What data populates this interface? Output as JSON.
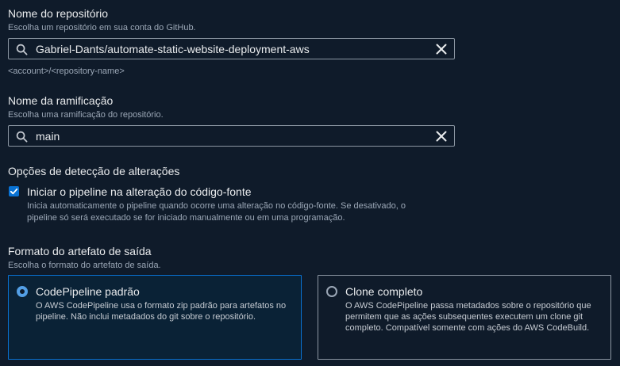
{
  "repository": {
    "label": "Nome do repositório",
    "description": "Escolha um repositório em sua conta do GitHub.",
    "value": "Gabriel-Dants/automate-static-website-deployment-aws",
    "hint": "<account>/<repository-name>"
  },
  "branch": {
    "label": "Nome da ramificação",
    "description": "Escolha uma ramificação do repositório.",
    "value": "main"
  },
  "change_detection": {
    "label": "Opções de detecção de alterações",
    "checkbox_label": "Iniciar o pipeline na alteração do código-fonte",
    "checkbox_checked": true,
    "checkbox_description_line1": "Inicia automaticamente o pipeline quando ocorre uma alteração no código-fonte. Se desativado, o",
    "checkbox_description_line2": "pipeline só será executado se for iniciado manualmente ou em uma programação."
  },
  "output_format": {
    "label": "Formato do artefato de saída",
    "description": "Escolha o formato do artefato de saída.",
    "options": [
      {
        "title": "CodePipeline padrão",
        "description": "O AWS CodePipeline usa o formato zip padrão para artefatos no pipeline. Não inclui metadados do git sobre o repositório.",
        "selected": true
      },
      {
        "title": "Clone completo",
        "description": "O AWS CodePipeline passa metadados sobre o repositório que permitem que as ações subsequentes executem um clone git completo. Compatível somente com ações do AWS CodeBuild.",
        "selected": false
      }
    ]
  },
  "colors": {
    "background": "#0f1b2a",
    "accent": "#0972d3",
    "radio_selected": "#539fe5",
    "border": "#8c97a3"
  },
  "icons": {
    "search": "search-icon",
    "clear": "close-icon",
    "check": "checkmark-icon"
  }
}
